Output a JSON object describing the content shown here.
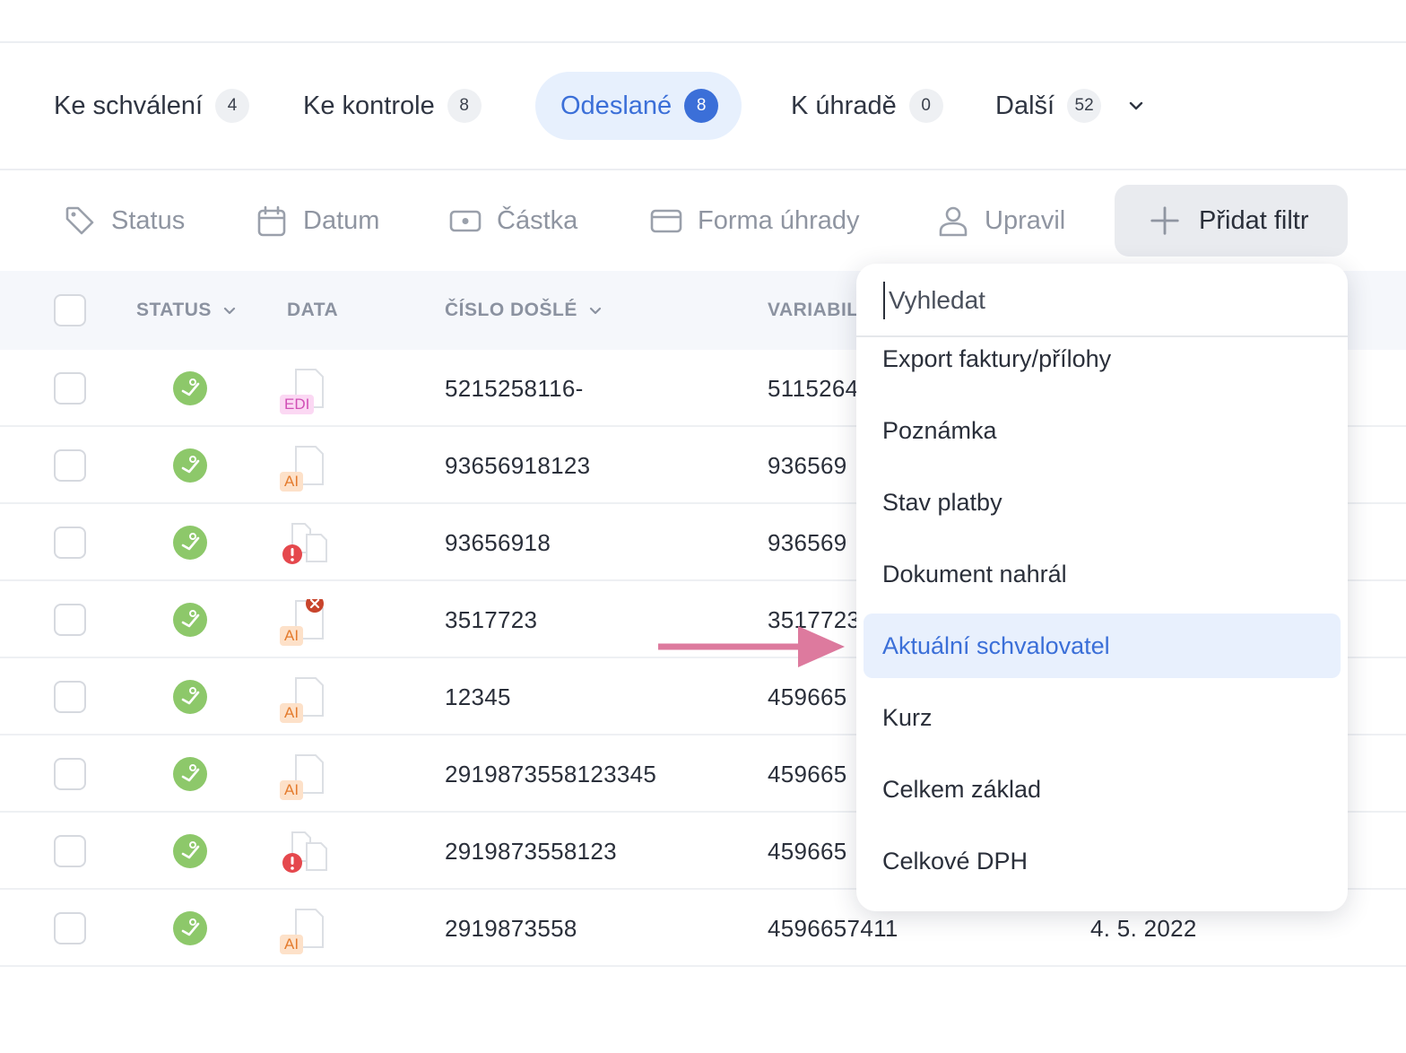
{
  "tabs": [
    {
      "label": "Ke schválení",
      "count": "4"
    },
    {
      "label": "Ke kontrole",
      "count": "8"
    },
    {
      "label": "Odeslané",
      "count": "8"
    },
    {
      "label": "K úhradě",
      "count": "0"
    },
    {
      "label": "Další",
      "count": "52"
    }
  ],
  "filters": {
    "status": "Status",
    "datum": "Datum",
    "castka": "Částka",
    "forma": "Forma úhrady",
    "upravil": "Upravil",
    "add": "Přidat filtr"
  },
  "table": {
    "headers": {
      "status": "STATUS",
      "data": "DATA",
      "cislo": "ČÍSLO DOŠLÉ",
      "variabil": "VARIABIL"
    },
    "rows": [
      {
        "badge": "EDI",
        "number": "5215258116-",
        "var": "5115264",
        "date": ""
      },
      {
        "badge": "AI",
        "number": "93656918123",
        "var": "936569",
        "date": ""
      },
      {
        "badge": "",
        "number": "93656918",
        "var": "936569",
        "date": ""
      },
      {
        "badge": "AI",
        "number": "3517723",
        "var": "3517723",
        "date": ""
      },
      {
        "badge": "AI",
        "number": "12345",
        "var": "459665",
        "date": ""
      },
      {
        "badge": "AI",
        "number": "2919873558123345",
        "var": "459665",
        "date": ""
      },
      {
        "badge": "",
        "number": "2919873558123",
        "var": "459665",
        "date": ""
      },
      {
        "badge": "AI",
        "number": "2919873558",
        "var": "4596657411",
        "date": "4. 5. 2022"
      }
    ]
  },
  "dropdown": {
    "search_placeholder": "Vyhledat",
    "items": [
      "Export faktury/přílohy",
      "Poznámka",
      "Stav platby",
      "Dokument nahrál",
      "Aktuální schvalovatel",
      "Kurz",
      "Celkem základ",
      "Celkové DPH"
    ],
    "highlighted": "Aktuální schvalovatel"
  },
  "colors": {
    "accent": "#3b6fd8",
    "status_green": "#8dc86a",
    "arrow": "#dd7a9e",
    "error": "#e5484d"
  }
}
